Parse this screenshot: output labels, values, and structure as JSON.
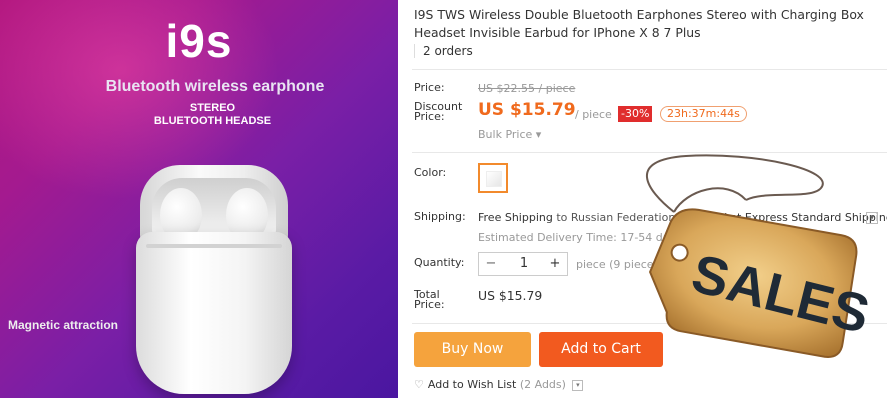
{
  "hero": {
    "title": "i9s",
    "subtitle": "Bluetooth wireless earphone",
    "stereo_line1": "STEREO",
    "stereo_line2": "BLUETOOTH HEADSE",
    "magnetic": "Magnetic attraction"
  },
  "product": {
    "title": "I9S TWS Wireless Double Bluetooth Earphones Stereo with Charging Box Headset Invisible Earbud for IPhone X 8 7 Plus",
    "orders": "2 orders"
  },
  "price": {
    "label": "Price:",
    "original": "US $22.55 / piece",
    "discount_label_1": "Discount",
    "discount_label_2": "Price:",
    "current": "US $15.79",
    "unit": "/ piece",
    "discount_pct": "-30%",
    "timer": "23h:37m:44s",
    "bulk": "Bulk Price ▾"
  },
  "color": {
    "label": "Color:"
  },
  "shipping": {
    "label": "Shipping:",
    "free": "Free Shipping",
    "to": " to Russian Federation via ",
    "method": "ePacket Express Standard Shipping",
    "estimated": "Estimated Delivery Time: 17-54 days"
  },
  "quantity": {
    "label": "Quantity:",
    "minus": "−",
    "value": "1",
    "plus": "+",
    "note": "piece (9 pieces available)"
  },
  "total": {
    "label_1": "Total",
    "label_2": "Price:",
    "value": "US $15.79"
  },
  "actions": {
    "buy_now": "Buy Now",
    "add_to_cart": "Add to Cart",
    "wishlist": "Add to Wish List",
    "wishlist_count": "(2 Adds)",
    "chevron": "▾"
  },
  "tag": {
    "text": "SALES"
  },
  "colors": {
    "accent_orange": "#f06a1d",
    "buy_now_bg": "#f5a33d",
    "cart_bg": "#f25a1f",
    "discount_bg": "#e02d2d",
    "hero_gradient_start": "#b2177f",
    "hero_gradient_end": "#4a16a0"
  },
  "icons": {
    "heart": "heart-icon",
    "chevron": "chevron-down-icon"
  }
}
